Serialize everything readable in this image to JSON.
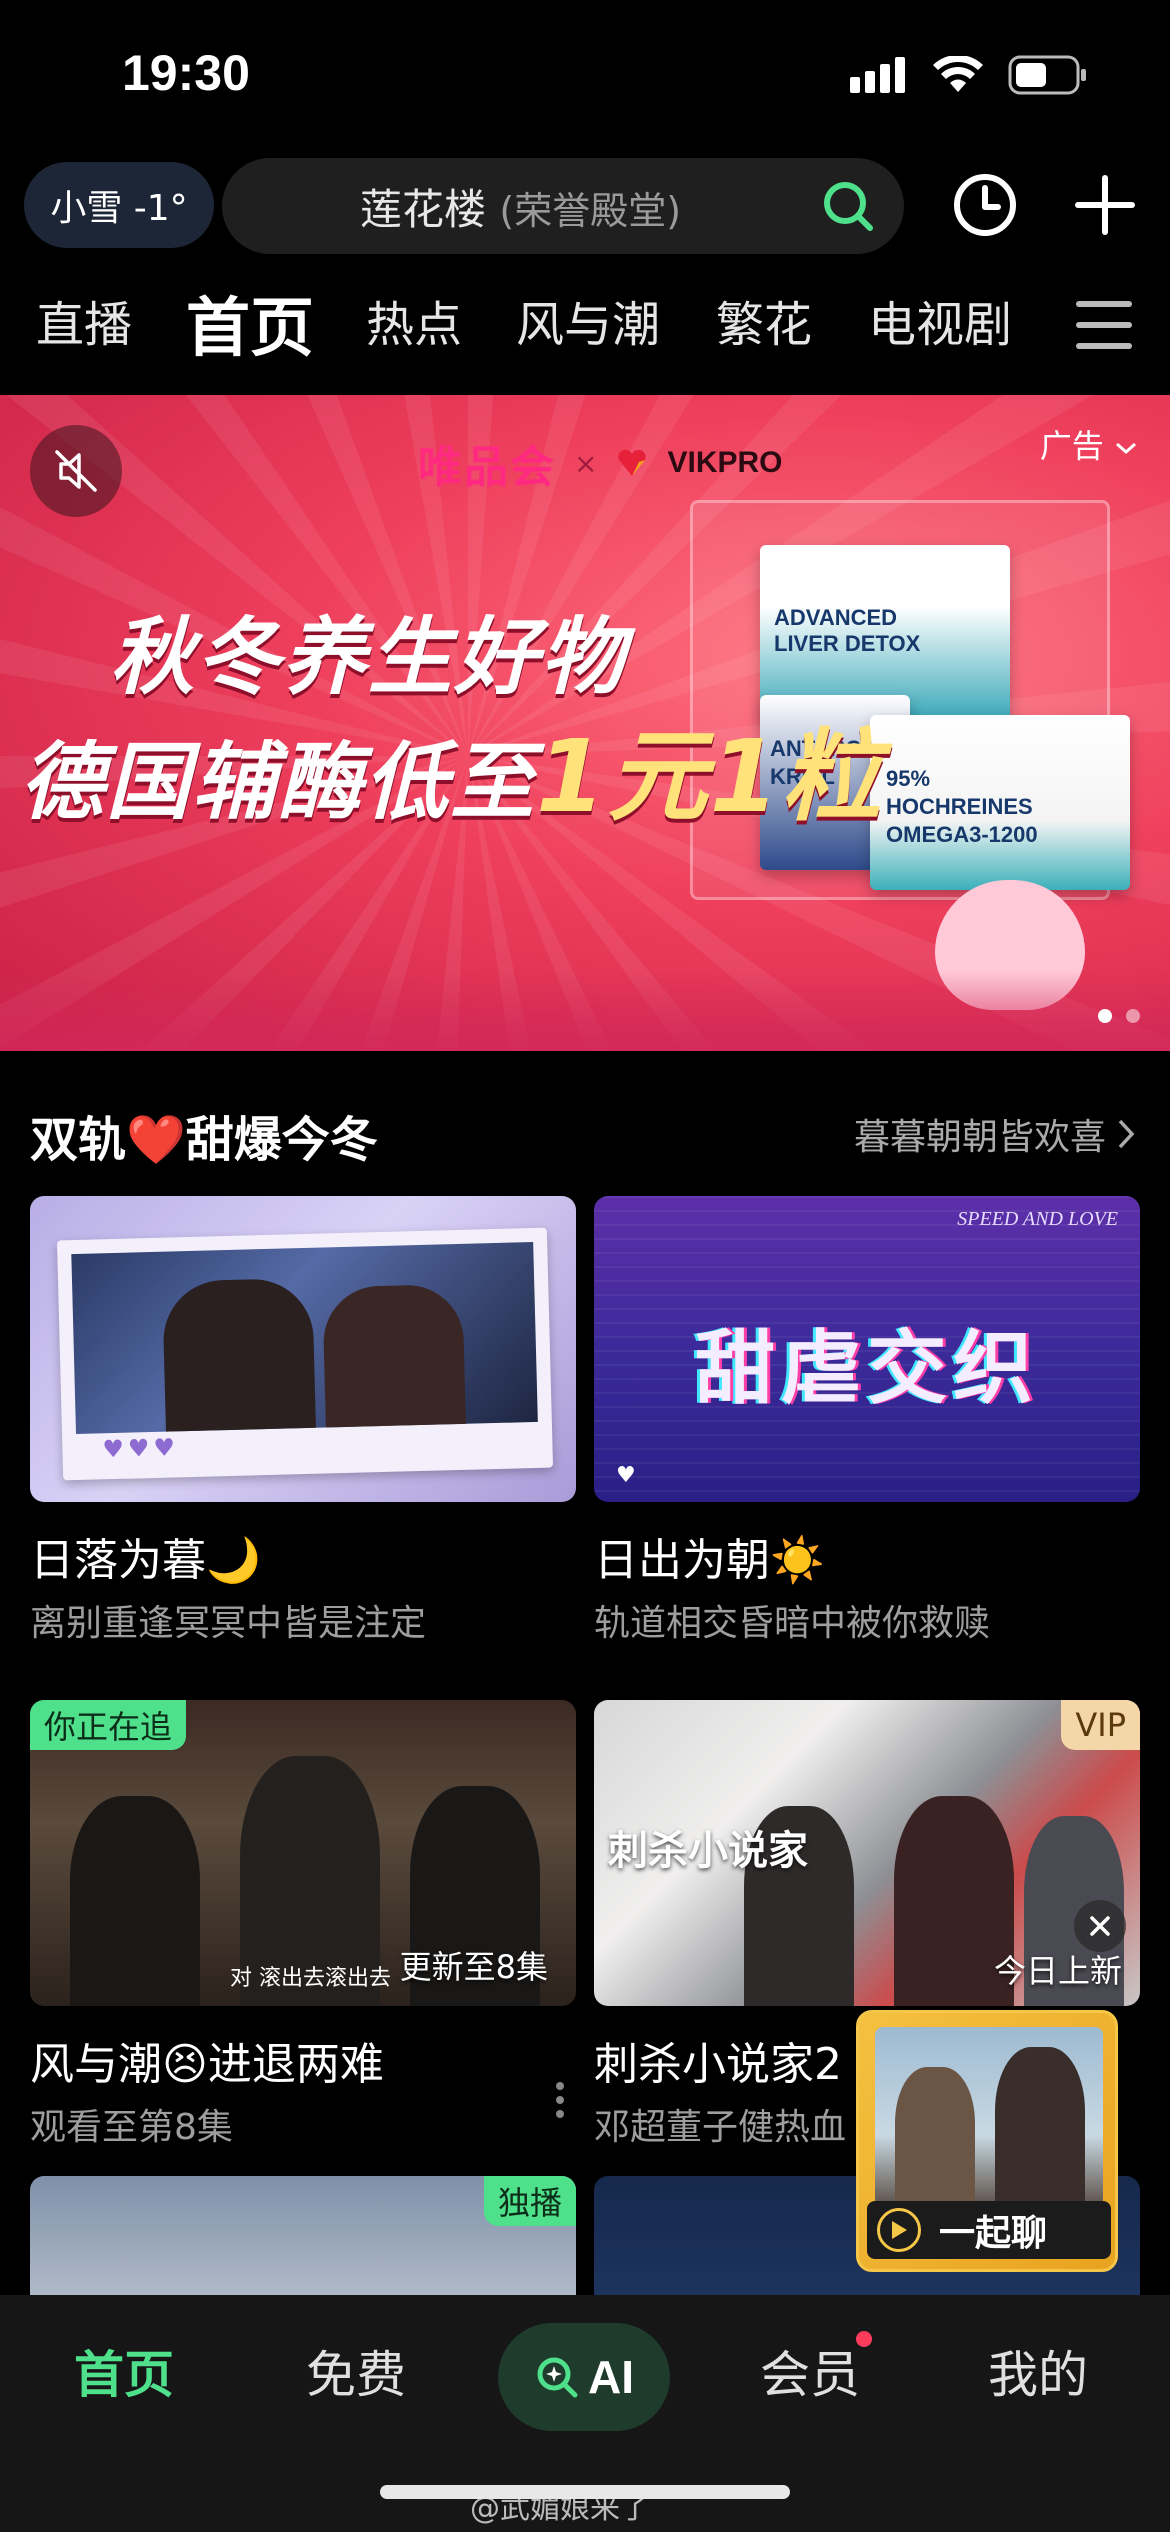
{
  "status_bar": {
    "time": "19:30"
  },
  "top_bar": {
    "weather": "小雪 -1°",
    "search": {
      "main_text": "莲花楼",
      "sub_text": "(荣誉殿堂)"
    }
  },
  "nav_tabs": [
    {
      "label": "直播",
      "active": false
    },
    {
      "label": "首页",
      "active": true
    },
    {
      "label": "热点",
      "active": false
    },
    {
      "label": "风与潮",
      "active": false
    },
    {
      "label": "繁花",
      "active": false
    },
    {
      "label": "电视剧",
      "active": false
    }
  ],
  "banner": {
    "ad_label": "广告",
    "brand_vip": "唯品会",
    "brand_x": "×",
    "brand_vik": "VIKPRO",
    "headline_1": "秋冬养生好物",
    "headline_2_prefix": "德国辅酶低至",
    "headline_2_highlight": "1元1粒",
    "product_1": "ADVANCED LIVER DETOX",
    "product_2": "ANTARCTI KRILL",
    "product_3": "95% HOCHREINES OMEGA3-1200",
    "page_indicator": 1,
    "total_pages": 2
  },
  "section": {
    "title": "双轨❤️甜爆今冬",
    "link": "暮暮朝朝皆欢喜"
  },
  "cards": [
    {
      "title": "日落为暮🌙",
      "subtitle": "离别重逢冥冥中皆是注定",
      "badge": "",
      "overlay": ""
    },
    {
      "title": "日出为朝☀️",
      "subtitle": "轨道相交昏暗中被你救赎",
      "badge": "",
      "overlay": "甜虐交织",
      "tag": "SPEED AND LOVE"
    },
    {
      "title": "风与潮😣进退两难",
      "subtitle": "观看至第8集",
      "badge": "你正在追",
      "overlay": "更新至8集",
      "caption": "对 滚出去滚出去"
    },
    {
      "title": "刺杀小说家2",
      "subtitle": "邓超董子健热血",
      "badge": "VIP",
      "overlay": "今日上新",
      "thumb_title": "刺杀小说家"
    },
    {
      "title": "",
      "subtitle": "",
      "badge": "独播",
      "overlay": ""
    },
    {
      "title": "",
      "subtitle": "",
      "badge": "",
      "overlay": ""
    }
  ],
  "float_widget": {
    "label": "一起聊"
  },
  "bottom_nav": {
    "home": "首页",
    "free": "免费",
    "ai": "AI",
    "vip": "会员",
    "mine": "我的"
  },
  "watermark": "@武媚娘来了",
  "colors": {
    "accent": "#4ee08a",
    "background": "#000000",
    "banner": "#ee3f5c"
  }
}
